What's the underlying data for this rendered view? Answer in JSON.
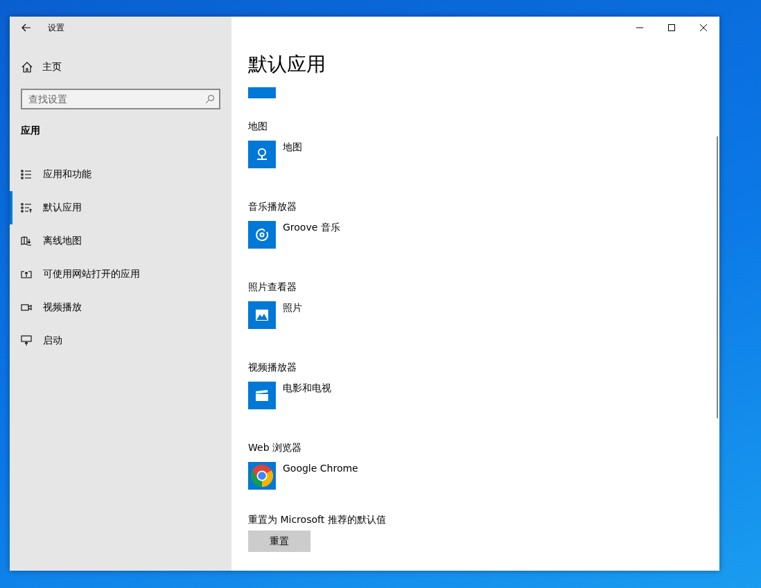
{
  "window": {
    "title": "设置"
  },
  "sidebar": {
    "home": "主页",
    "search": {
      "placeholder": "查找设置"
    },
    "section": "应用",
    "items": [
      {
        "label": "应用和功能",
        "kind": "list",
        "selected": false
      },
      {
        "label": "默认应用",
        "kind": "defaults",
        "selected": true
      },
      {
        "label": "离线地图",
        "kind": "offline-map",
        "selected": false
      },
      {
        "label": "可使用网站打开的应用",
        "kind": "web-apps",
        "selected": false
      },
      {
        "label": "视频播放",
        "kind": "video",
        "selected": false
      },
      {
        "label": "启动",
        "kind": "startup",
        "selected": false
      }
    ]
  },
  "page": {
    "title": "默认应用",
    "defaults": [
      {
        "category": "地图",
        "app": "地图",
        "kind": "map"
      },
      {
        "category": "音乐播放器",
        "app": "Groove 音乐",
        "kind": "music"
      },
      {
        "category": "照片查看器",
        "app": "照片",
        "kind": "photos"
      },
      {
        "category": "视频播放器",
        "app": "电影和电视",
        "kind": "video"
      },
      {
        "category": "Web 浏览器",
        "app": "Google Chrome",
        "kind": "browser"
      }
    ],
    "reset": {
      "label": "重置为 Microsoft 推荐的默认值",
      "button": "重置"
    }
  }
}
